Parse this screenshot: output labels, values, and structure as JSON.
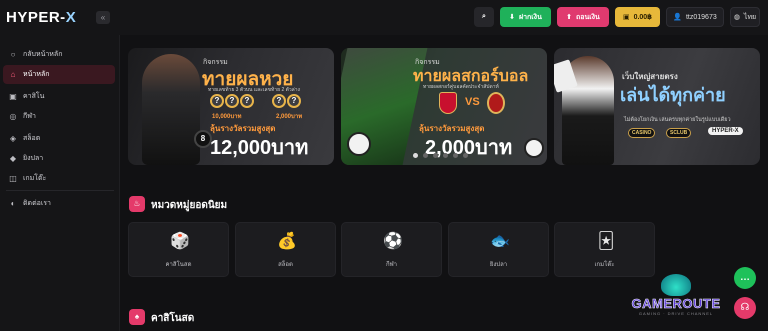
{
  "header": {
    "logo_main": "HYPER-",
    "logo_x": "X",
    "collapse_glyph": "«",
    "search_icon": "⌕",
    "deposit_label": "ฝากเงิน",
    "withdraw_label": "ถอนเงิน",
    "balance": "0.00฿",
    "username": "ttz019673",
    "language": "ไทย"
  },
  "sidebar": {
    "items": [
      {
        "label": "กลับหน้าหลัก",
        "icon": "circle-icon",
        "glyph": "○"
      },
      {
        "label": "หน้าหลัก",
        "icon": "home-icon",
        "glyph": "⌂",
        "active": true
      },
      {
        "label": "คาสิโน",
        "icon": "cards-icon",
        "glyph": "▣"
      },
      {
        "label": "กีฬา",
        "icon": "ball-icon",
        "glyph": "◎"
      },
      {
        "label": "สล็อต",
        "icon": "slot-icon",
        "glyph": "◈"
      },
      {
        "label": "ยิงปลา",
        "icon": "fish-icon",
        "glyph": "◆"
      },
      {
        "label": "เกมโต๊ะ",
        "icon": "table-icon",
        "glyph": "◫"
      },
      {
        "label": "ติดต่อเรา",
        "icon": "chat-icon",
        "glyph": "◐"
      }
    ]
  },
  "banners": {
    "b1": {
      "activity": "กิจกรรม",
      "title": "ทายผลหวย",
      "sub": "ทายเลขท้าย 3 ตัวบน และเลขท้าย 2 ตัวล่าง",
      "prize1": "10,000บาท",
      "prize2": "2,000บาท",
      "reward_label": "ลุ้นรางวัลรวมสูงสุด",
      "amount": "12,000บาท"
    },
    "b2": {
      "activity": "กิจกรรม",
      "title": "ทายผลสกอร์บอล",
      "sub": "ทายผลสกอร์คู่บอลคัดประจำสัปดาห์",
      "vs": "VS",
      "reward_label": "ลุ้นรางวัลรวมสูงสุด",
      "amount": "2,000บาท"
    },
    "b3": {
      "line1": "เว็บใหญ่สายตรง",
      "title": "เล่นได้ทุกค่าย",
      "sub": "ไม่ต้องโยกเงิน เล่นครบทุกค่ายในรูปแบบเดียว",
      "logo_a": "CASINO",
      "logo_b": "SCLUB",
      "logo_c": "HYPER-X"
    },
    "dots": 6,
    "active_dot": 0
  },
  "popular": {
    "title": "หมวดหมู่ยอดนิยม",
    "cards": [
      {
        "label": "คาสิโนสด",
        "icon": "roulette-icon",
        "glyph": "🎲"
      },
      {
        "label": "สล็อต",
        "icon": "treasure-icon",
        "glyph": "💰"
      },
      {
        "label": "กีฬา",
        "icon": "soccer-ball-icon",
        "glyph": "⚽"
      },
      {
        "label": "ยิงปลา",
        "icon": "fish-icon",
        "glyph": "🐟"
      },
      {
        "label": "เกมโต๊ะ",
        "icon": "card-table-icon",
        "glyph": "🃏"
      }
    ]
  },
  "casino_section": {
    "title": "คาสิโนสด"
  },
  "watermark": {
    "name": "GAMEROUTE",
    "sub": "GAMING · DRIVE CHANNEL"
  },
  "colors": {
    "accent": "#e43a6a",
    "deposit": "#1fb15a",
    "balance": "#e7b83a"
  }
}
